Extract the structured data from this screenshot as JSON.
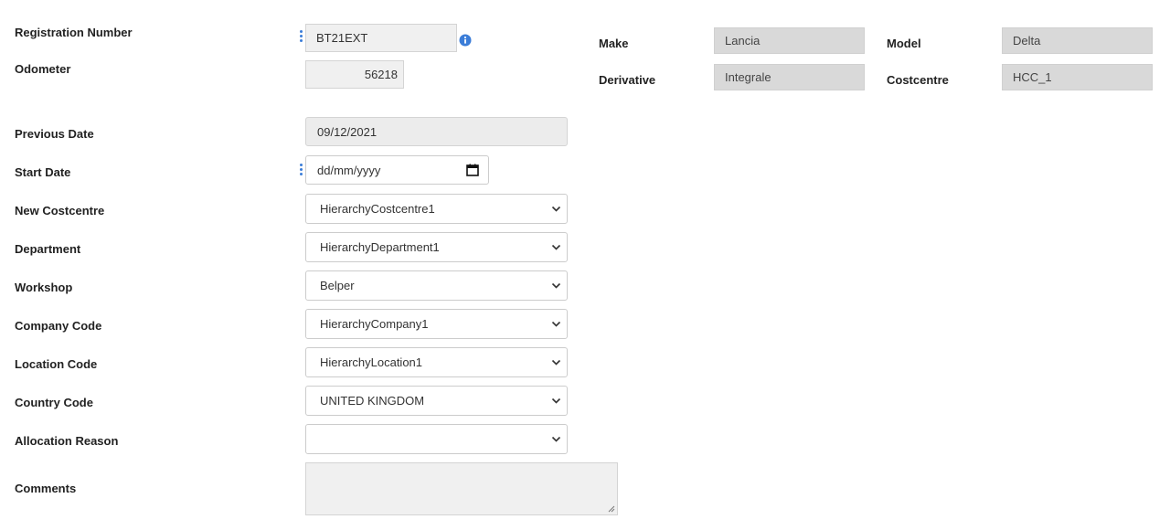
{
  "labels": {
    "registration_number": "Registration Number",
    "odometer": "Odometer",
    "previous_date": "Previous Date",
    "start_date": "Start Date",
    "new_costcentre": "New Costcentre",
    "department": "Department",
    "workshop": "Workshop",
    "company_code": "Company Code",
    "location_code": "Location Code",
    "country_code": "Country Code",
    "allocation_reason": "Allocation Reason",
    "comments": "Comments",
    "make": "Make",
    "model": "Model",
    "derivative": "Derivative",
    "costcentre": "Costcentre"
  },
  "values": {
    "registration_number": "BT21EXT",
    "odometer": "56218",
    "previous_date": "09/12/2021",
    "start_date_placeholder": "dd/mm/yyyy",
    "new_costcentre": "HierarchyCostcentre1",
    "department": "HierarchyDepartment1",
    "workshop": "Belper",
    "company_code": "HierarchyCompany1",
    "location_code": "HierarchyLocation1",
    "country_code": "UNITED KINGDOM",
    "allocation_reason": "",
    "comments": "",
    "make": "Lancia",
    "model": "Delta",
    "derivative": "Integrale",
    "costcentre": "HCC_1"
  },
  "icons": {
    "info": "info-icon",
    "calendar": "calendar-icon",
    "dropdown": "chevron-down-icon",
    "menu": "vertical-dots-icon"
  },
  "colors": {
    "accent": "#3b7dd8",
    "readonly_bg": "#d9d9d9",
    "input_bg": "#f0f0f0"
  }
}
